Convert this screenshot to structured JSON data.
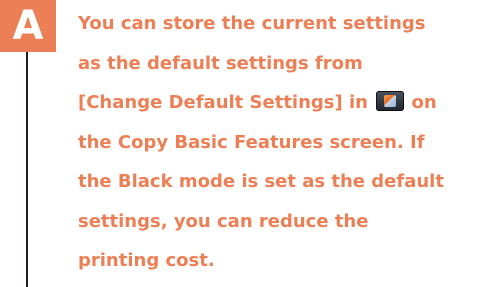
{
  "badge": {
    "letter": "A"
  },
  "colors": {
    "badge_bg": "#ec7f55",
    "text": "#ec7f55",
    "rule": "#231f20"
  },
  "answer": {
    "line1": "You can store the current settings",
    "line2": "as the default settings from",
    "line3_before_icon": "[Change Default Settings] in ",
    "line3_after_icon": " on",
    "line4": "the Copy Basic Features screen. If",
    "line5": "the Black mode is set as the default",
    "line6": "settings, you can reduce the",
    "line7": "printing cost.",
    "icon": "settings-menu-icon"
  }
}
